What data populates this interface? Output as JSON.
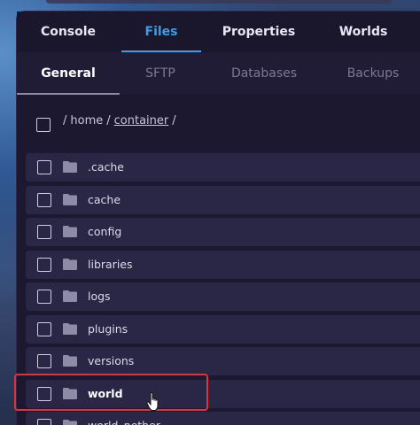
{
  "tabs": [
    {
      "label": "Console"
    },
    {
      "label": "Files"
    },
    {
      "label": "Properties"
    },
    {
      "label": "Worlds"
    }
  ],
  "subtabs": [
    {
      "label": "General"
    },
    {
      "label": "SFTP"
    },
    {
      "label": "Databases"
    },
    {
      "label": "Backups"
    }
  ],
  "breadcrumb": {
    "sep1": "/",
    "home": "home",
    "sep2": "/",
    "container": "container",
    "sep3": "/"
  },
  "files": [
    {
      "name": ".cache",
      "icon": "folder-icon"
    },
    {
      "name": "cache",
      "icon": "folder-icon"
    },
    {
      "name": "config",
      "icon": "folder-icon"
    },
    {
      "name": "libraries",
      "icon": "folder-icon"
    },
    {
      "name": "logs",
      "icon": "folder-icon"
    },
    {
      "name": "plugins",
      "icon": "folder-icon"
    },
    {
      "name": "versions",
      "icon": "folder-icon"
    },
    {
      "name": "world",
      "icon": "folder-icon",
      "highlighted": true
    },
    {
      "name": "world_nether",
      "icon": "folder-icon"
    }
  ],
  "colors": {
    "accent": "#3a9ee8",
    "highlight_box": "#e0323c",
    "folder": "#8f8ba6"
  }
}
